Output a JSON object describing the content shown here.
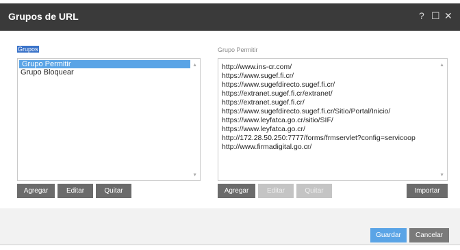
{
  "dialog": {
    "title": "Grupos de URL",
    "help_glyph": "?",
    "maximize_glyph": "☐",
    "close_glyph": "✕"
  },
  "groups": {
    "label": "Grupos",
    "items": [
      "Grupo Permitir",
      "Grupo Bloquear"
    ],
    "buttons": {
      "add": "Agregar",
      "edit": "Editar",
      "remove": "Quitar"
    }
  },
  "urls": {
    "label": "Grupo Permitir",
    "items": [
      "http://www.ins-cr.com/",
      "https://www.sugef.fi.cr/",
      "https://www.sugefdirecto.sugef.fi.cr/",
      "https://extranet.sugef.fi.cr/extranet/",
      "https://extranet.sugef.fi.cr/",
      "https://www.sugefdirecto.sugef.fi.cr/Sitio/Portal/Inicio/",
      "https://www.leyfatca.go.cr/sitio/SIF/",
      "https://www.leyfatca.go.cr/",
      "http://172.28.50.250:7777/forms/frmservlet?config=servicoop",
      "http://www.firmadigital.go.cr/"
    ],
    "buttons": {
      "add": "Agregar",
      "edit": "Editar",
      "remove": "Quitar",
      "import": "Importar"
    }
  },
  "footer": {
    "save": "Guardar",
    "cancel": "Cancelar"
  },
  "colors": {
    "titlebar": "#3a3a3a",
    "accent": "#5aa4e6",
    "button": "#6b6b6b"
  }
}
